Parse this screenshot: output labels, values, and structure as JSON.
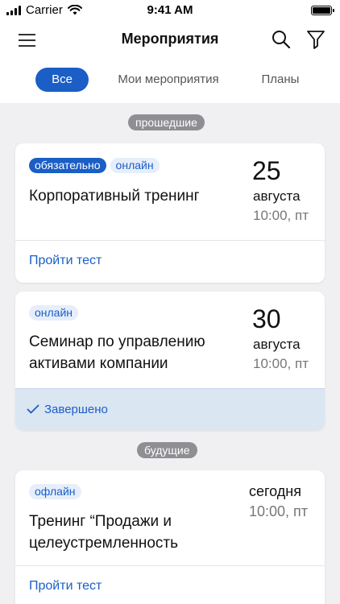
{
  "status_bar": {
    "carrier": "Carrier",
    "time": "9:41 AM"
  },
  "header": {
    "title": "Мероприятия"
  },
  "tabs": [
    {
      "label": "Все",
      "active": true
    },
    {
      "label": "Мои мероприятия",
      "active": false
    },
    {
      "label": "Планы",
      "active": false
    }
  ],
  "sections": {
    "past": "прошедшие",
    "future": "будущие"
  },
  "events": [
    {
      "badges": [
        "обязательно",
        "онлайн"
      ],
      "title": "Корпоративный тренинг",
      "day": "25",
      "month": "августа",
      "time": "10:00, пт",
      "action": "Пройти тест"
    },
    {
      "badges": [
        "онлайн"
      ],
      "title_line1": "Семинар по управлению",
      "title_line2": "активами компании",
      "day": "30",
      "month": "августа",
      "time": "10:00, пт",
      "status": "Завершено"
    },
    {
      "badges": [
        "офлайн"
      ],
      "title_line1": "Тренинг “Продажи и",
      "title_line2": "целеустремленность",
      "day_label": "сегодня",
      "time": "10:00, пт",
      "action": "Пройти тест"
    }
  ],
  "colors": {
    "accent": "#1a5ec6",
    "badge_soft_bg": "#e6eefb",
    "completed_bg": "#dbe6f3",
    "section_label_bg": "#8e8e93"
  },
  "icons": [
    "signal-icon",
    "wifi-icon",
    "battery-icon",
    "menu-icon",
    "search-icon",
    "filter-icon",
    "check-icon"
  ]
}
